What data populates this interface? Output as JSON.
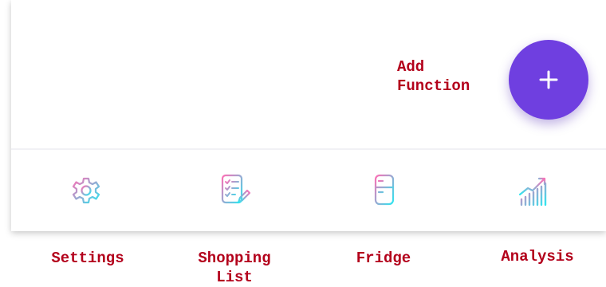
{
  "fab": {
    "icon": "plus-icon",
    "color": "#6f3fe0"
  },
  "nav": [
    {
      "id": "settings",
      "icon": "gear-icon"
    },
    {
      "id": "shopping-list",
      "icon": "checklist-icon"
    },
    {
      "id": "fridge",
      "icon": "fridge-icon"
    },
    {
      "id": "analysis",
      "icon": "bar-chart-icon"
    }
  ],
  "annotations": {
    "add_function": [
      "Add",
      "Function"
    ],
    "settings": [
      "Settings"
    ],
    "shopping_list": [
      "Shopping",
      "List"
    ],
    "fridge": [
      "Fridge"
    ],
    "analysis": [
      "Analysis"
    ],
    "color": "#b3001b"
  },
  "icon_gradient": [
    "#ff6fb5",
    "#2ee6f0"
  ]
}
